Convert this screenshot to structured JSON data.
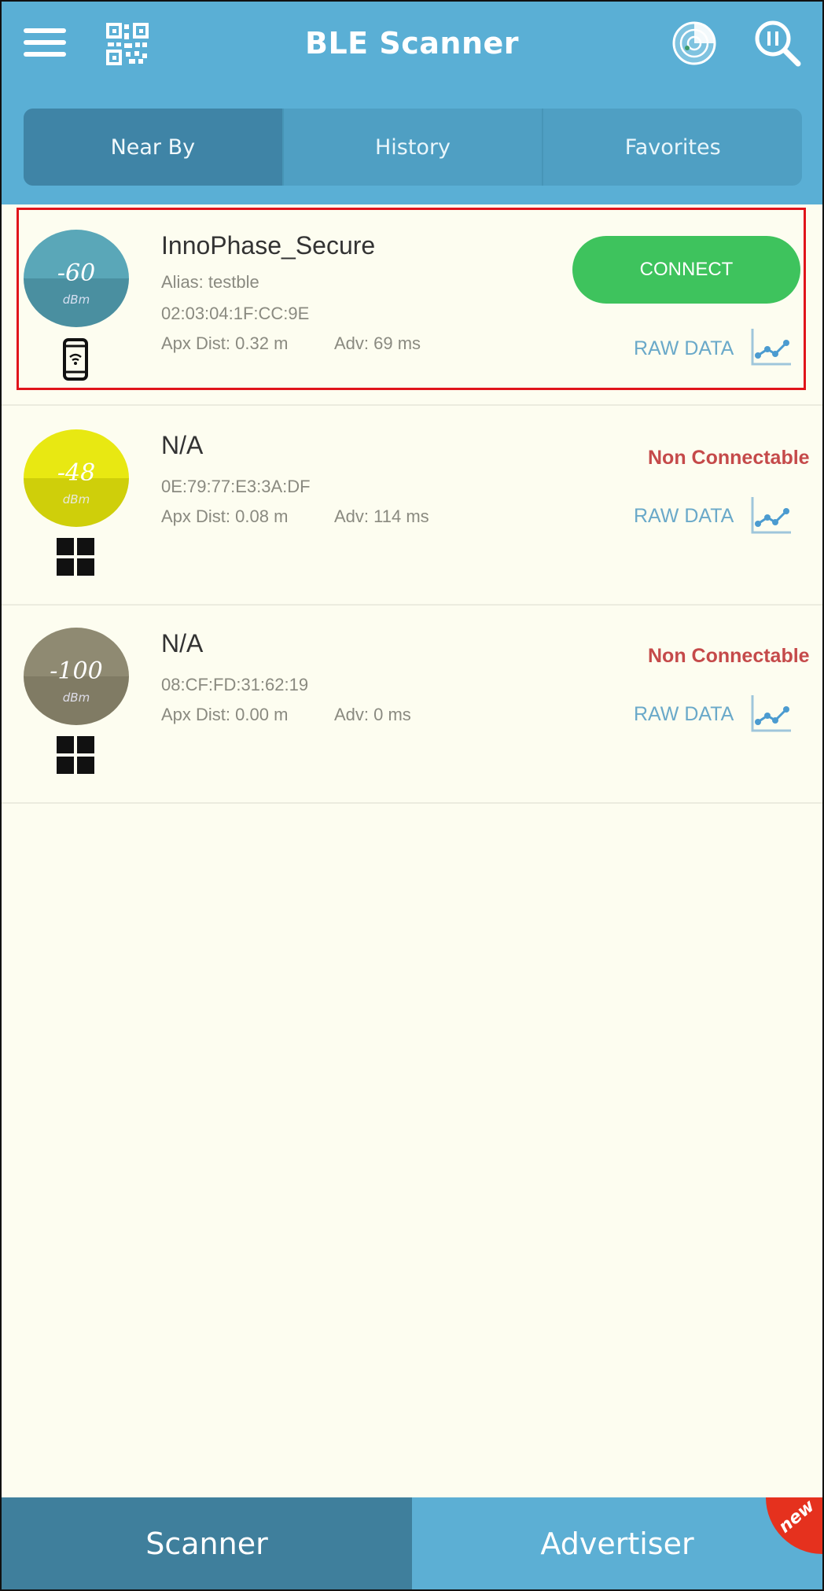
{
  "app": {
    "title": "BLE Scanner"
  },
  "header": {
    "icons": [
      "menu-icon",
      "qr-code-icon",
      "radar-icon",
      "search-icon"
    ]
  },
  "tabs": [
    {
      "label": "Near By",
      "active": true
    },
    {
      "label": "History",
      "active": false
    },
    {
      "label": "Favorites",
      "active": false
    }
  ],
  "devices": [
    {
      "name": "InnoPhase_Secure",
      "alias": "Alias: testble",
      "mac": "02:03:04:1F:CC:9E",
      "distance": "Apx Dist: 0.32 m",
      "adv": "Adv: 69 ms",
      "rssi": "-60",
      "rssi_unit": "dBm",
      "rssi_colors": [
        "#5aa7b8",
        "#4a8fa0"
      ],
      "device_icon": "phone-icon",
      "action": "CONNECT",
      "raw_data": "RAW DATA",
      "highlighted": true
    },
    {
      "name": "N/A",
      "mac": "0E:79:77:E3:3A:DF",
      "distance": "Apx Dist: 0.08 m",
      "adv": "Adv: 114 ms",
      "rssi": "-48",
      "rssi_unit": "dBm",
      "rssi_colors": [
        "#e8e812",
        "#cfcf0a"
      ],
      "device_icon": "windows-icon",
      "status": "Non Connectable",
      "raw_data": "RAW DATA"
    },
    {
      "name": "N/A",
      "mac": "08:CF:FD:31:62:19",
      "distance": "Apx Dist: 0.00 m",
      "adv": "Adv: 0 ms",
      "rssi": "-100",
      "rssi_unit": "dBm",
      "rssi_colors": [
        "#8f8a72",
        "#807b64"
      ],
      "device_icon": "windows-icon",
      "status": "Non Connectable",
      "raw_data": "RAW DATA"
    }
  ],
  "bottom_nav": {
    "scanner": "Scanner",
    "advertiser": "Advertiser",
    "badge": "new"
  },
  "colors": {
    "header": "#5aafd5",
    "connect": "#3ec35d",
    "non_connectable": "#c54a4a",
    "raw_data": "#6aa9c9",
    "highlight_border": "#e0141b"
  }
}
